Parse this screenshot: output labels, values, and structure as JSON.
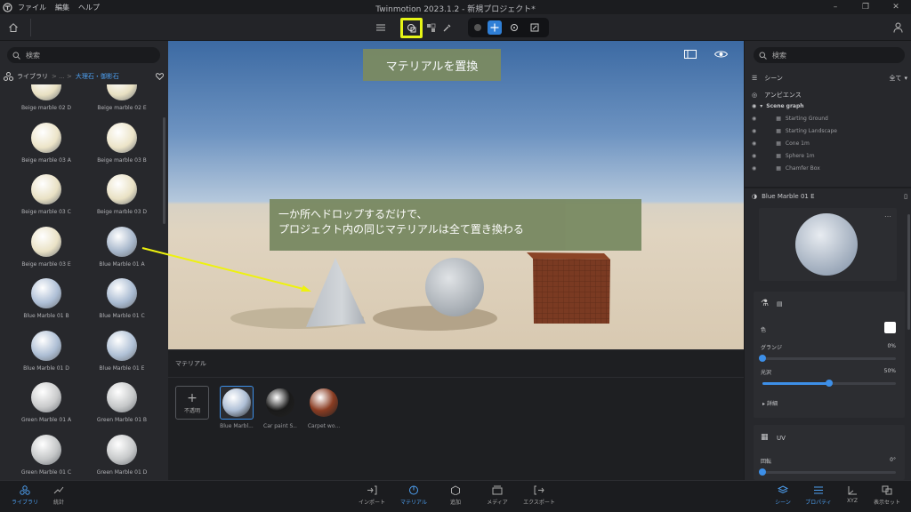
{
  "menu": {
    "items": [
      "ファイル",
      "編集",
      "ヘルプ"
    ]
  },
  "window": {
    "title": "Twinmotion 2023.1.2 - 新規プロジェクト*"
  },
  "library": {
    "search_placeholder": "検索",
    "breadcrumb": {
      "root": "ライブラリ",
      "sep1": "> ... >",
      "current": "大理石・御影石"
    },
    "items": [
      {
        "label": "Beige marble 02 D",
        "color": "#e8e0c2"
      },
      {
        "label": "Beige marble 02 E",
        "color": "#e8e0c2"
      },
      {
        "label": "Beige marble 03 A",
        "color": "#ece4c8"
      },
      {
        "label": "Beige marble 03 B",
        "color": "#ece4c8"
      },
      {
        "label": "Beige marble 03 C",
        "color": "#e9e1c4"
      },
      {
        "label": "Beige marble 03 D",
        "color": "#e9e1c4"
      },
      {
        "label": "Beige marble 03 E",
        "color": "#eae2c6"
      },
      {
        "label": "Blue Marble 01 A",
        "color": "#a8b8cc"
      },
      {
        "label": "Blue Marble 01 B",
        "color": "#aebfd6"
      },
      {
        "label": "Blue Marble 01 C",
        "color": "#a9bbd2"
      },
      {
        "label": "Blue Marble 01 D",
        "color": "#adbed4"
      },
      {
        "label": "Blue Marble 01 E",
        "color": "#b0c1d6"
      },
      {
        "label": "Green Marble 01 A",
        "color": "#c9cacb"
      },
      {
        "label": "Green Marble 01 B",
        "color": "#c6c8c9"
      },
      {
        "label": "Green Marble 01 C",
        "color": "#c4c6c7"
      },
      {
        "label": "Green Marble 01 D",
        "color": "#c7c9ca"
      }
    ]
  },
  "annotations": {
    "toolbar_tip": "マテリアルを置換",
    "viewport_tip_line1": "一か所へドロップするだけで、",
    "viewport_tip_line2": "プロジェクト内の同じマテリアルは全て置き換わる"
  },
  "materials_panel": {
    "title": "マテリアル",
    "add_label": "不透明",
    "items": [
      {
        "label": "Blue Marbl...",
        "color": "#aebfd6"
      },
      {
        "label": "Car paint S...",
        "color": "#1a1a1a"
      },
      {
        "label": "Carpet wo...",
        "color": "#8a3c22"
      }
    ]
  },
  "scene": {
    "search_placeholder": "検索",
    "title": "シーン",
    "filter": "全て",
    "ambience": "アンビエンス",
    "graph": "Scene graph",
    "nodes": [
      "Starting Ground",
      "Starting Landscape",
      "Cone 1m",
      "Sphere 1m",
      "Chamfer Box"
    ]
  },
  "properties": {
    "material_name": "Blue Marble 01 E",
    "color_label": "色",
    "grunge_label": "グランジ",
    "grunge_value": "0%",
    "grunge_level": 0,
    "gloss_label": "光沢",
    "gloss_value": "50%",
    "gloss_level": 0.5,
    "details_label": "詳細",
    "uv_label": "UV",
    "rotation_label": "回転",
    "rotation_value": "0°",
    "rotation_level": 0
  },
  "bottom": {
    "left": [
      {
        "label": "ライブラリ"
      },
      {
        "label": "統計"
      }
    ],
    "center": [
      {
        "label": "インポート"
      },
      {
        "label": "マテリアル"
      },
      {
        "label": "追加"
      },
      {
        "label": "メディア"
      },
      {
        "label": "エクスポート"
      }
    ],
    "right": [
      {
        "label": "シーン"
      },
      {
        "label": "プロパティ"
      },
      {
        "label": "XYZ"
      },
      {
        "label": "表示セット"
      }
    ]
  },
  "colors": {
    "accent": "#3d8fe8",
    "highlight": "#e6f516",
    "annotation_bg": "#7a8a63"
  }
}
